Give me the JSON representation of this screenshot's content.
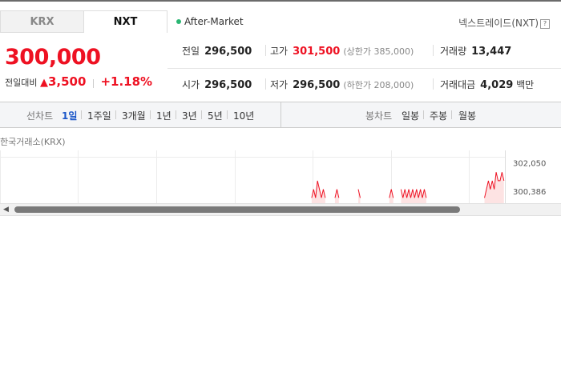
{
  "tabs": [
    {
      "label": "KRX"
    },
    {
      "label": "NXT"
    }
  ],
  "after_market": "After-Market",
  "nxt_link": "넥스트레이드(NXT)",
  "help": "?",
  "price": "300,000",
  "change": {
    "label": "전일대비",
    "arrow": "▲",
    "value": "3,500",
    "percent": "+1.18%"
  },
  "stats": {
    "prev_close": {
      "label": "전일",
      "value": "296,500"
    },
    "high": {
      "label": "고가",
      "value": "301,500",
      "sub": "(상한가 385,000)"
    },
    "volume": {
      "label": "거래량",
      "value": "13,447"
    },
    "open": {
      "label": "시가",
      "value": "296,500"
    },
    "low": {
      "label": "저가",
      "value": "296,500",
      "sub": "(하한가 208,000)"
    },
    "amount": {
      "label": "거래대금",
      "value": "4,029",
      "unit": "백만"
    }
  },
  "toolbar": {
    "line_label": "선차트",
    "line_items": [
      "1일",
      "1주일",
      "3개월",
      "1년",
      "3년",
      "5년",
      "10년"
    ],
    "candle_label": "봉차트",
    "candle_items": [
      "일봉",
      "주봉",
      "월봉"
    ]
  },
  "exchange_label": "한국거래소(KRX)",
  "chart_data": {
    "type": "line",
    "title": "",
    "xlabel": "",
    "ylabel": "",
    "y_ticks": [
      "302,050",
      "300,386"
    ],
    "ylim": [
      299500,
      302400
    ],
    "grid": true,
    "series": [
      {
        "values": [
          null,
          null,
          null,
          null,
          null,
          null,
          null,
          null,
          null,
          null,
          null,
          null,
          null,
          null,
          null,
          null,
          null,
          null,
          null,
          null,
          null,
          null,
          null,
          null,
          null,
          null,
          null,
          null,
          null,
          null,
          null,
          null,
          null,
          null,
          null,
          null,
          null,
          null,
          null,
          null,
          null,
          null,
          null,
          null,
          null,
          null,
          null,
          null,
          null,
          null,
          null,
          null,
          null,
          null,
          null,
          null,
          null,
          null,
          null,
          null,
          null,
          null,
          null,
          null,
          null,
          null,
          null,
          null,
          null,
          null,
          null,
          null,
          null,
          null,
          null,
          null,
          null,
          null,
          null,
          null,
          null,
          null,
          null,
          null,
          null,
          null,
          null,
          null,
          null,
          null,
          null,
          null,
          null,
          null,
          null,
          null,
          null,
          null,
          null,
          null,
          null,
          null,
          null,
          null,
          null,
          null,
          null,
          null,
          null,
          null,
          null,
          null,
          null,
          null,
          null,
          null,
          null,
          null,
          null,
          null,
          null,
          null,
          null,
          null,
          null,
          null,
          null,
          null,
          null,
          null,
          null,
          null,
          null,
          null,
          null,
          null,
          null,
          null,
          null,
          null,
          null,
          null,
          null,
          null,
          null,
          null,
          null,
          null,
          null,
          null,
          null,
          null,
          null,
          null,
          null,
          null,
          null,
          null,
          null,
          null,
          300000,
          300500,
          300000,
          301000,
          300500,
          300000,
          300500,
          300000,
          null,
          null,
          null,
          null,
          300000,
          300500,
          300000,
          null,
          null,
          null,
          null,
          null,
          null,
          null,
          null,
          null,
          300500,
          300000,
          null,
          null,
          null,
          null,
          null,
          null,
          null,
          null,
          null,
          null,
          null,
          null,
          null,
          null,
          300000,
          300500,
          300000,
          null,
          null,
          null,
          300500,
          300000,
          300500,
          300000,
          300500,
          300000,
          300500,
          300000,
          300500,
          300000,
          300500,
          300000,
          300500,
          300000,
          null,
          null,
          null,
          null,
          null,
          null,
          null,
          null,
          null,
          null,
          null,
          null,
          null,
          null,
          null,
          null,
          null,
          null,
          null,
          null,
          null,
          null,
          null,
          null,
          null,
          null,
          null,
          null,
          null,
          300000,
          300500,
          301000,
          300500,
          301000,
          300500,
          301500,
          301000,
          301000,
          301500,
          301000
        ]
      }
    ]
  }
}
